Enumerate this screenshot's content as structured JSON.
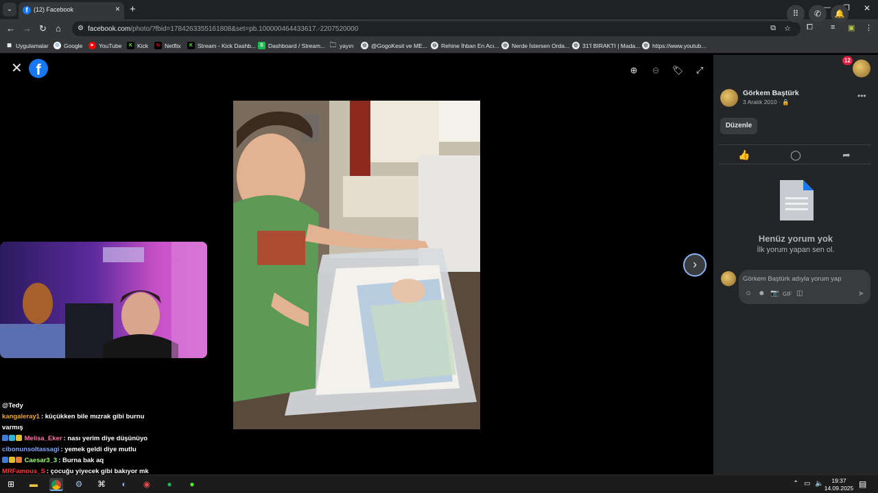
{
  "browser": {
    "tab_title": "(12) Facebook",
    "url_host": "facebook.com",
    "url_path": "/photo/?fbid=1784263355161808&set=pb.100000464433617.-2207520000"
  },
  "bookmarks": [
    {
      "label": "Uygulamalar",
      "color": "#5f6368",
      "glyph": "▦"
    },
    {
      "label": "Google",
      "color": "#4285f4",
      "glyph": "G"
    },
    {
      "label": "YouTube",
      "color": "#ff0000",
      "glyph": "▶"
    },
    {
      "label": "Kick",
      "color": "#53fc18",
      "glyph": "K"
    },
    {
      "label": "Netflix",
      "color": "#e50914",
      "glyph": "N"
    },
    {
      "label": "Stream - Kick Dashb...",
      "color": "#53fc18",
      "glyph": "K"
    },
    {
      "label": "Dashboard / Stream...",
      "color": "#1db954",
      "glyph": "S"
    },
    {
      "label": "yayın",
      "color": "transparent",
      "glyph": "🗀"
    },
    {
      "label": "@GogoKesit ve ME...",
      "color": "#5f6368",
      "glyph": "◎"
    },
    {
      "label": "Rehine İhban En Acı...",
      "color": "#5f6368",
      "glyph": "◎"
    },
    {
      "label": "Nerde İstersen Orda...",
      "color": "#5f6368",
      "glyph": "◎"
    },
    {
      "label": "31'İ BIRAKTI | Mada...",
      "color": "#5f6368",
      "glyph": "◎"
    },
    {
      "label": "https://www.youtub...",
      "color": "#5f6368",
      "glyph": "◎"
    }
  ],
  "chat": {
    "header": "@Tedy",
    "messages": [
      {
        "user": "kangaleray1",
        "color": "#f5a623",
        "badges": [],
        "text": ": küçükken bile mızrak gibi burnu varmış"
      },
      {
        "user": "Melisa_Eker",
        "color": "#ff6fa8",
        "badges": [
          "#3d7bd9",
          "#30b3d6",
          "#e0c030"
        ],
        "text": ": nası yerim diye düşünüyo"
      },
      {
        "user": "cibonunsoltassagi",
        "color": "#7da7ff",
        "badges": [],
        "text": ": yemek geldi diye mutlu"
      },
      {
        "user": "Caesar3_3",
        "color": "#9bff6e",
        "badges": [
          "#3d7bd9",
          "#e0c030",
          "#e07b30"
        ],
        "text": ": Burna bak aq"
      },
      {
        "user": "MRFamous_S",
        "color": "#ff3b3b",
        "badges": [],
        "text": ": çocuğu yiyecek gibi bakıyor mk"
      }
    ]
  },
  "notifications_count": "12",
  "post": {
    "author": "Görkem Baştürk",
    "date": "3 Aralık 2010 · ",
    "edit_label": "Düzenle"
  },
  "comments": {
    "empty_title": "Henüz yorum yok",
    "empty_subtitle": "İlk yorum yapan sen ol.",
    "input_placeholder": "Görkem Baştürk adıyla yorum yap"
  },
  "taskbar": {
    "time": "19:37",
    "date": "14.09.2025"
  }
}
